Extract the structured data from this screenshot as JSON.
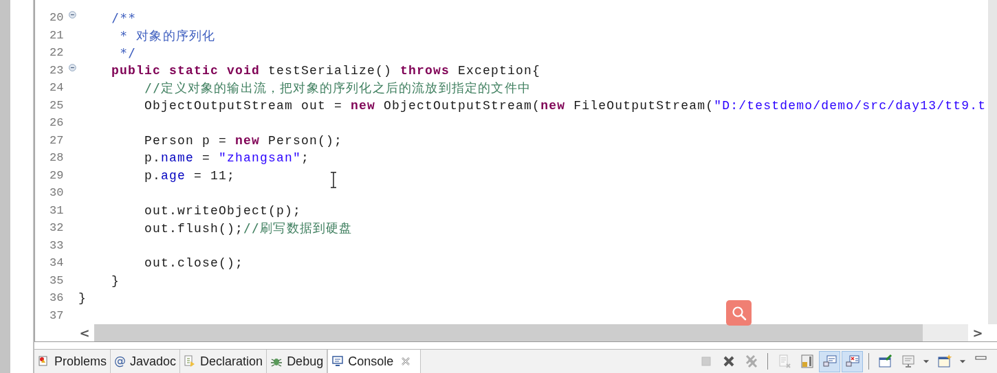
{
  "editor": {
    "lines": [
      {
        "number": "20",
        "kind": "fold",
        "expanded": true,
        "code": [
          {
            "kind": "doc",
            "t": "    /**"
          }
        ]
      },
      {
        "number": "21",
        "kind": "line",
        "code": [
          {
            "kind": "doc",
            "t": "     * 对象的序列化"
          }
        ]
      },
      {
        "number": "22",
        "kind": "line",
        "code": [
          {
            "kind": "doc",
            "t": "     */"
          }
        ]
      },
      {
        "number": "23",
        "kind": "fold",
        "expanded": true,
        "code": [
          {
            "kind": "kw",
            "t": "    public static void"
          },
          {
            "kind": "plain",
            "t": " testSerialize() "
          },
          {
            "kind": "kw",
            "t": "throws"
          },
          {
            "kind": "plain",
            "t": " Exception{"
          }
        ]
      },
      {
        "number": "24",
        "kind": "line",
        "code": [
          {
            "kind": "comment",
            "t": "        //定义对象的输出流，把对象的序列化之后的流放到指定的文件中"
          }
        ]
      },
      {
        "number": "25",
        "kind": "line",
        "code": [
          {
            "kind": "plain",
            "t": "        ObjectOutputStream out = "
          },
          {
            "kind": "kw",
            "t": "new"
          },
          {
            "kind": "plain",
            "t": " ObjectOutputStream("
          },
          {
            "kind": "kw",
            "t": "new"
          },
          {
            "kind": "plain",
            "t": " FileOutputStream("
          },
          {
            "kind": "str",
            "t": "\"D:/testdemo/demo/src/day13/tt9.t"
          }
        ]
      },
      {
        "number": "26",
        "kind": "line"
      },
      {
        "number": "27",
        "kind": "line",
        "code": [
          {
            "kind": "plain",
            "t": "        Person p = "
          },
          {
            "kind": "kw",
            "t": "new"
          },
          {
            "kind": "plain",
            "t": " Person();"
          }
        ]
      },
      {
        "number": "28",
        "kind": "line",
        "code": [
          {
            "kind": "plain",
            "t": "        p."
          },
          {
            "kind": "field",
            "t": "name"
          },
          {
            "kind": "plain",
            "t": " = "
          },
          {
            "kind": "str",
            "t": "\"zhangsan\""
          },
          {
            "kind": "plain",
            "t": ";"
          }
        ]
      },
      {
        "number": "29",
        "kind": "line",
        "code": [
          {
            "kind": "plain",
            "t": "        p."
          },
          {
            "kind": "field",
            "t": "age"
          },
          {
            "kind": "plain",
            "t": " = 11;"
          }
        ]
      },
      {
        "number": "30",
        "kind": "line"
      },
      {
        "number": "31",
        "kind": "line",
        "code": [
          {
            "kind": "plain",
            "t": "        out.writeObject(p);"
          }
        ]
      },
      {
        "number": "32",
        "kind": "line",
        "code": [
          {
            "kind": "plain",
            "t": "        out.flush();"
          },
          {
            "kind": "comment",
            "t": "//刷写数据到硬盘"
          }
        ]
      },
      {
        "number": "33",
        "kind": "line"
      },
      {
        "number": "34",
        "kind": "line",
        "code": [
          {
            "kind": "plain",
            "t": "        out.close();"
          }
        ]
      },
      {
        "number": "35",
        "kind": "line",
        "code": [
          {
            "kind": "plain",
            "t": "    }"
          }
        ]
      },
      {
        "number": "36",
        "kind": "line",
        "code": [
          {
            "kind": "plain",
            "t": "}"
          }
        ]
      },
      {
        "number": "37",
        "kind": "line"
      }
    ],
    "scroll_left": "<",
    "scroll_right": ">"
  },
  "bottom_tabs": [
    {
      "kind": "problems",
      "label": "Problems",
      "selected": false
    },
    {
      "kind": "javadoc",
      "glyph": "@",
      "label": "Javadoc",
      "selected": false
    },
    {
      "kind": "declaration",
      "label": "Declaration",
      "selected": false
    },
    {
      "kind": "debug",
      "label": "Debug",
      "selected": false
    },
    {
      "kind": "console",
      "label": "Console",
      "selected": true
    }
  ],
  "toolbar": [
    {
      "kind": "stop",
      "pressed": false,
      "disabled": true
    },
    {
      "kind": "remove",
      "pressed": false,
      "disabled": false
    },
    {
      "kind": "remove-all",
      "pressed": false,
      "disabled": true
    },
    {
      "kind": "sep"
    },
    {
      "kind": "clear",
      "pressed": false,
      "disabled": true
    },
    {
      "kind": "scroll-lock",
      "pressed": false,
      "disabled": false
    },
    {
      "kind": "show-out",
      "pressed": true,
      "disabled": false
    },
    {
      "kind": "show-err",
      "pressed": true,
      "disabled": false
    },
    {
      "kind": "sep"
    },
    {
      "kind": "pin",
      "pressed": false,
      "disabled": false
    },
    {
      "kind": "display",
      "pressed": false,
      "disabled": false
    },
    {
      "kind": "dropdown",
      "pressed": false,
      "disabled": false
    },
    {
      "kind": "open",
      "pressed": false,
      "disabled": false
    },
    {
      "kind": "dropdown",
      "pressed": false,
      "disabled": false
    },
    {
      "kind": "minimize",
      "pressed": false,
      "disabled": false
    }
  ]
}
